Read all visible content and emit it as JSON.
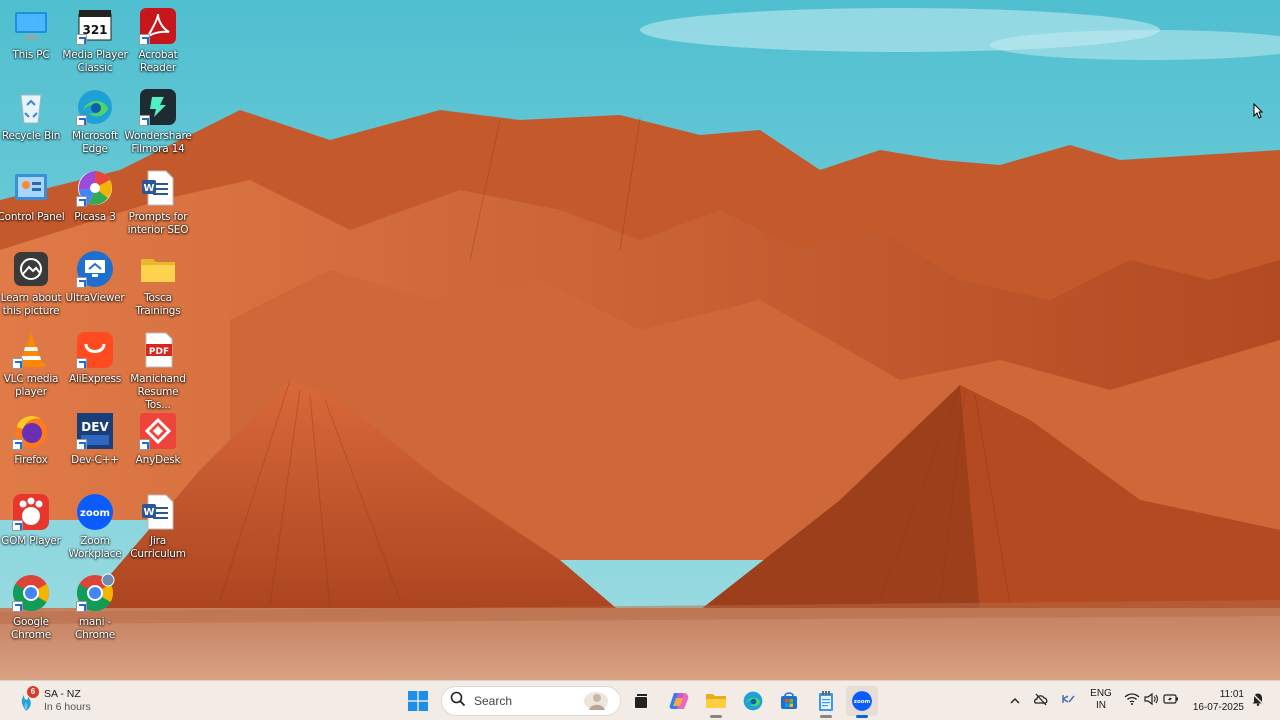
{
  "desktop": {
    "icons": [
      {
        "label": "This PC",
        "icon": "this-pc-icon"
      },
      {
        "label": "Media Player Classic",
        "icon": "media-player-classic-icon"
      },
      {
        "label": "Acrobat Reader",
        "icon": "acrobat-reader-icon"
      },
      {
        "label": "Recycle Bin",
        "icon": "recycle-bin-icon"
      },
      {
        "label": "Microsoft Edge",
        "icon": "edge-icon"
      },
      {
        "label": "Wondershare Filmora 14",
        "icon": "filmora-icon"
      },
      {
        "label": "Control Panel",
        "icon": "control-panel-icon"
      },
      {
        "label": "Picasa 3",
        "icon": "picasa-icon"
      },
      {
        "label": "Prompts for interior SEO",
        "icon": "word-document-icon"
      },
      {
        "label": "Learn about this picture",
        "icon": "learn-picture-icon"
      },
      {
        "label": "UltraViewer",
        "icon": "ultraviewer-icon"
      },
      {
        "label": "Tosca Trainings",
        "icon": "folder-icon"
      },
      {
        "label": "VLC media player",
        "icon": "vlc-icon"
      },
      {
        "label": "AliExpress",
        "icon": "aliexpress-icon"
      },
      {
        "label": "Manichand Resume Tos...",
        "icon": "pdf-document-icon"
      },
      {
        "label": "Firefox",
        "icon": "firefox-icon"
      },
      {
        "label": "Dev-C++",
        "icon": "devcpp-icon"
      },
      {
        "label": "AnyDesk",
        "icon": "anydesk-icon"
      },
      {
        "label": "GOM Player",
        "icon": "gom-player-icon"
      },
      {
        "label": "Zoom Workplace",
        "icon": "zoom-icon"
      },
      {
        "label": "Jira Curriculum",
        "icon": "word-document-icon"
      },
      {
        "label": "Google Chrome",
        "icon": "chrome-icon"
      },
      {
        "label": "mani - Chrome",
        "icon": "chrome-profile-icon"
      }
    ]
  },
  "taskbar": {
    "weather": {
      "badge": "6",
      "location": "SA - NZ",
      "sub": "In 6 hours"
    },
    "search_placeholder": "Search",
    "pinned": [
      "start-icon",
      "search-icon",
      "task-view-icon",
      "copilot-icon",
      "file-explorer-icon",
      "edge-icon",
      "microsoft-store-icon",
      "notepad-icon",
      "zoom-icon"
    ],
    "tray": {
      "lang_line1": "ENG",
      "lang_line2": "IN",
      "time": "11:01",
      "date": "16-07-2025"
    }
  },
  "colors": {
    "sky": "#62c6d4",
    "rock": "#c8562a",
    "taskbar": "#f3ece6",
    "accent": "#0a64d8"
  }
}
